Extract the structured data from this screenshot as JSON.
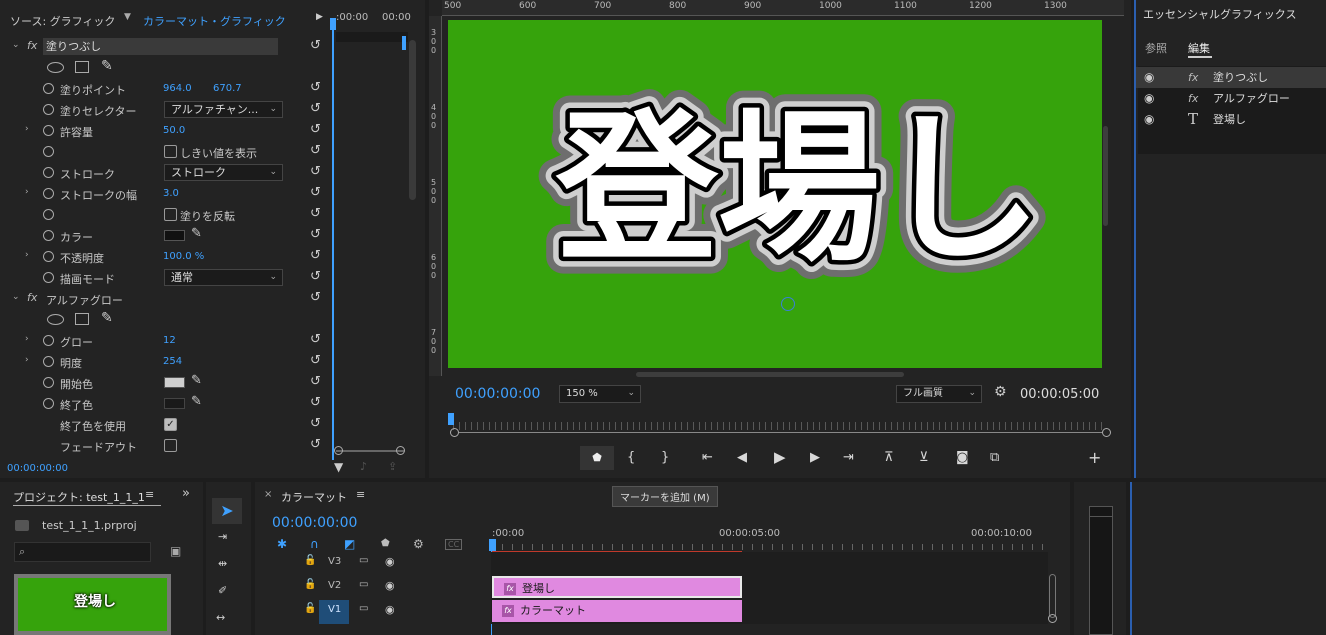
{
  "effect_controls": {
    "tab_source": "ソース: グラフィック",
    "tab_clip": "カラーマット・グラフィック",
    "ruler_start": ":00:00",
    "ruler_end": "00:00",
    "timecode": "00:00:00:00",
    "effect1": "塗りつぶし",
    "effect2": "アルファグロー",
    "fx_glyph": "fx",
    "rows": {
      "fill_point": {
        "label": "塗りポイント",
        "x": "964.0",
        "y": "670.7"
      },
      "fill_selector": {
        "label": "塗りセレクター",
        "value": "アルファチャン..."
      },
      "tolerance": {
        "label": "許容量",
        "value": "50.0"
      },
      "show_threshold": {
        "label": "しきい値を表示"
      },
      "stroke": {
        "label": "ストローク",
        "value": "ストローク"
      },
      "stroke_width": {
        "label": "ストロークの幅",
        "value": "3.0"
      },
      "invert_fill": {
        "label": "塗りを反転"
      },
      "color": {
        "label": "カラー",
        "swatch": "#111111"
      },
      "opacity": {
        "label": "不透明度",
        "value": "100.0 %"
      },
      "blend_mode": {
        "label": "描画モード",
        "value": "通常"
      },
      "glow": {
        "label": "グロー",
        "value": "12"
      },
      "brightness": {
        "label": "明度",
        "value": "254"
      },
      "start_color": {
        "label": "開始色",
        "swatch": "#cfcfcf"
      },
      "end_color": {
        "label": "終了色",
        "swatch": "#1a1a1a"
      },
      "use_end_color": {
        "label": "終了色を使用",
        "checked": true
      },
      "fade_out": {
        "label": "フェードアウト",
        "checked": false
      }
    }
  },
  "program": {
    "ruler_labels": [
      "500",
      "600",
      "700",
      "800",
      "900",
      "1000",
      "1100",
      "1200",
      "1300"
    ],
    "vruler_labels": [
      "3\n0\n0",
      "4\n0\n0",
      "5\n0\n0",
      "6\n0\n0",
      "7\n0\n0"
    ],
    "title_text": "登場し",
    "bg_color": "#36a30c",
    "timecode": "00:00:00:00",
    "zoom": "150 %",
    "quality": "フル画質",
    "duration": "00:00:05:00",
    "tooltip": "マーカーを追加 (M)"
  },
  "essential_graphics": {
    "title": "エッセンシャルグラフィックス",
    "tab_browse": "参照",
    "tab_edit": "編集",
    "layers": [
      {
        "kind": "fx",
        "label": "塗りつぶし"
      },
      {
        "kind": "fx",
        "label": "アルファグロー"
      },
      {
        "kind": "T",
        "label": "登場し"
      }
    ]
  },
  "project": {
    "title": "プロジェクト: test_1_1_1",
    "file": "test_1_1_1.prproj",
    "search_placeholder": "",
    "thumb_text": "登場し",
    "more": "»"
  },
  "timeline": {
    "title": "カラーマット",
    "timecode": "00:00:00:00",
    "ruler": [
      ":00:00",
      "00:00:05:00",
      "00:00:10:00"
    ],
    "tracks": [
      "V3",
      "V2",
      "V1"
    ],
    "clips": [
      {
        "track": "V2",
        "label": "登場し"
      },
      {
        "track": "V1",
        "label": "カラーマット"
      }
    ]
  }
}
